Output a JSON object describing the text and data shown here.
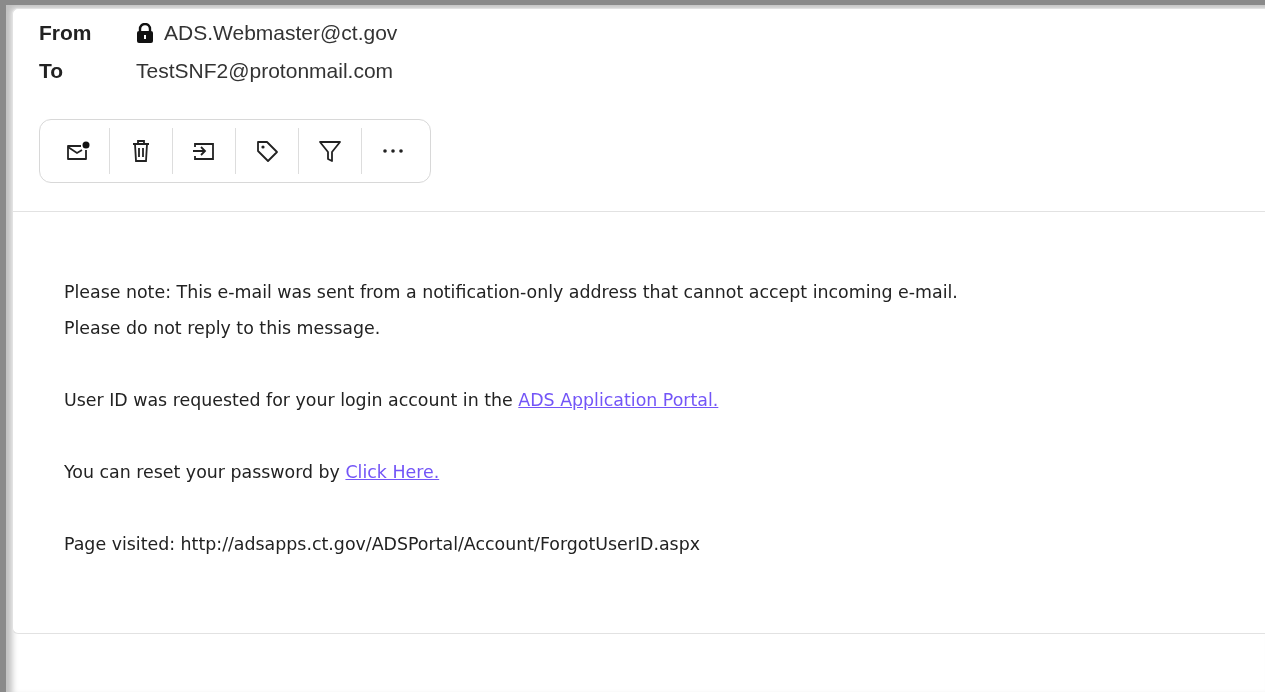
{
  "header": {
    "from_label": "From",
    "from": "ADS.Webmaster@ct.gov",
    "from_locked": true,
    "to_label": "To",
    "to": "TestSNF2@protonmail.com"
  },
  "toolbar": [
    {
      "kind": "unread"
    },
    {
      "kind": "trash"
    },
    {
      "kind": "move"
    },
    {
      "kind": "label"
    },
    {
      "kind": "filter"
    },
    {
      "kind": "more"
    }
  ],
  "body": [
    {
      "lines": [
        "Please note: This e-mail was sent from a notification-only address that cannot accept incoming e-mail.",
        "Please do not reply to this message."
      ]
    },
    {
      "text": "User ID was requested for your login account in the ",
      "link": "ADS Application Portal."
    },
    {
      "text": "You can reset your password by ",
      "link": "Click Here."
    },
    {
      "lines": [
        "Page visited: http://adsapps.ct.gov/ADSPortal/Account/ForgotUserID.aspx"
      ]
    }
  ]
}
